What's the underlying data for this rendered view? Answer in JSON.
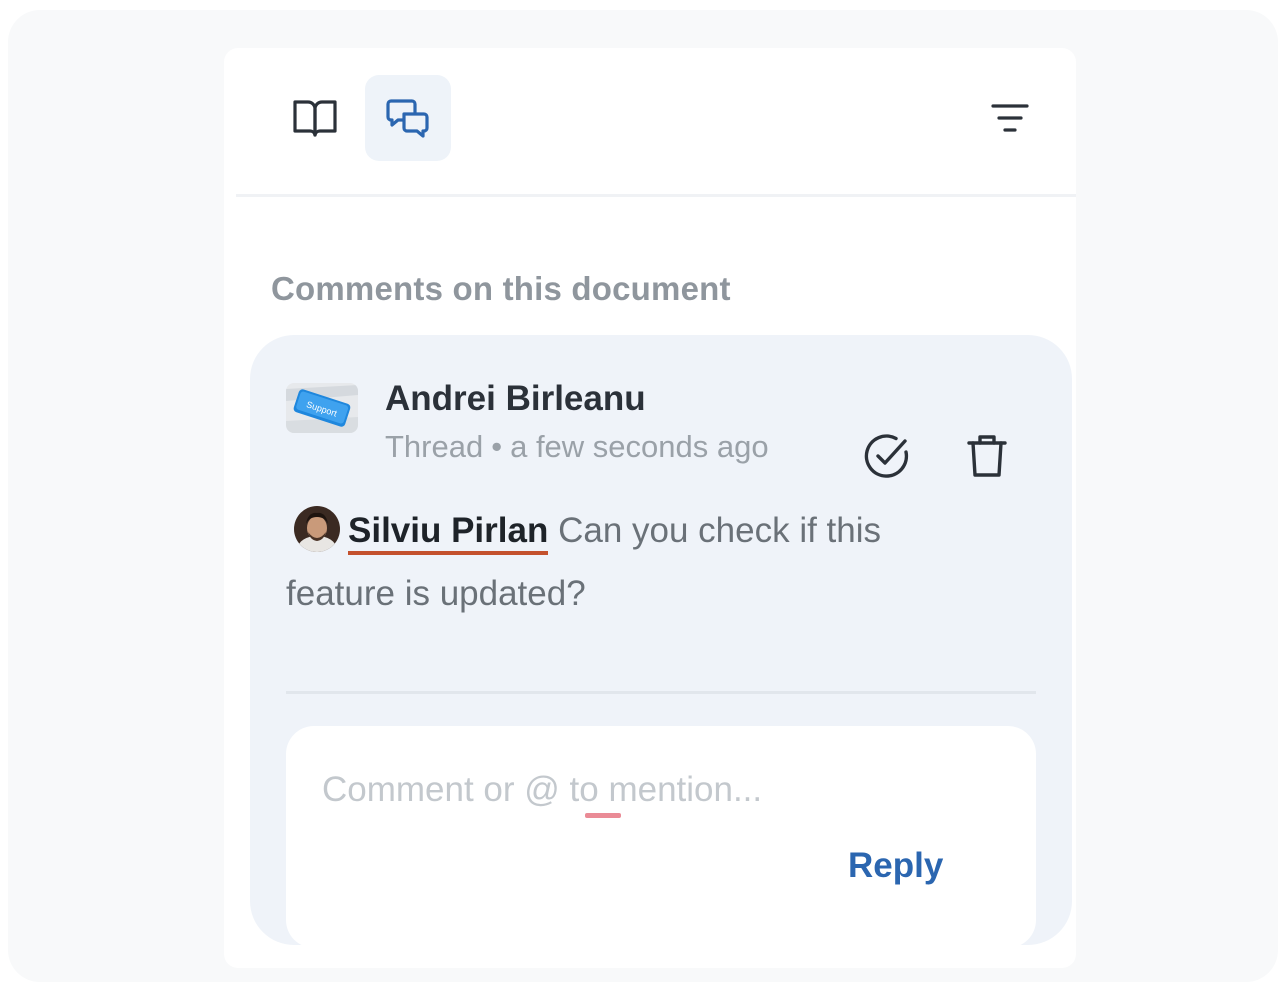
{
  "toolbar": {
    "tabs": [
      {
        "name": "book-icon",
        "active": false
      },
      {
        "name": "comments-icon",
        "active": true
      }
    ],
    "filter_icon": "filter-lines-icon"
  },
  "section": {
    "title": "Comments on this document"
  },
  "thread": {
    "author": "Andrei Birleanu",
    "type": "Thread",
    "separator": "•",
    "time": "a few seconds ago",
    "avatar_label": "Support",
    "resolve_icon": "check-circle-icon",
    "delete_icon": "trash-icon",
    "mention": "Silviu Pirlan",
    "message": "Can you check if this feature is updated?"
  },
  "reply": {
    "placeholder": "Comment or @ to mention...",
    "button_label": "Reply"
  },
  "colors": {
    "accent": "#2b66b0",
    "card_bg": "#eff3f9",
    "mention_underline": "#c4512e"
  }
}
